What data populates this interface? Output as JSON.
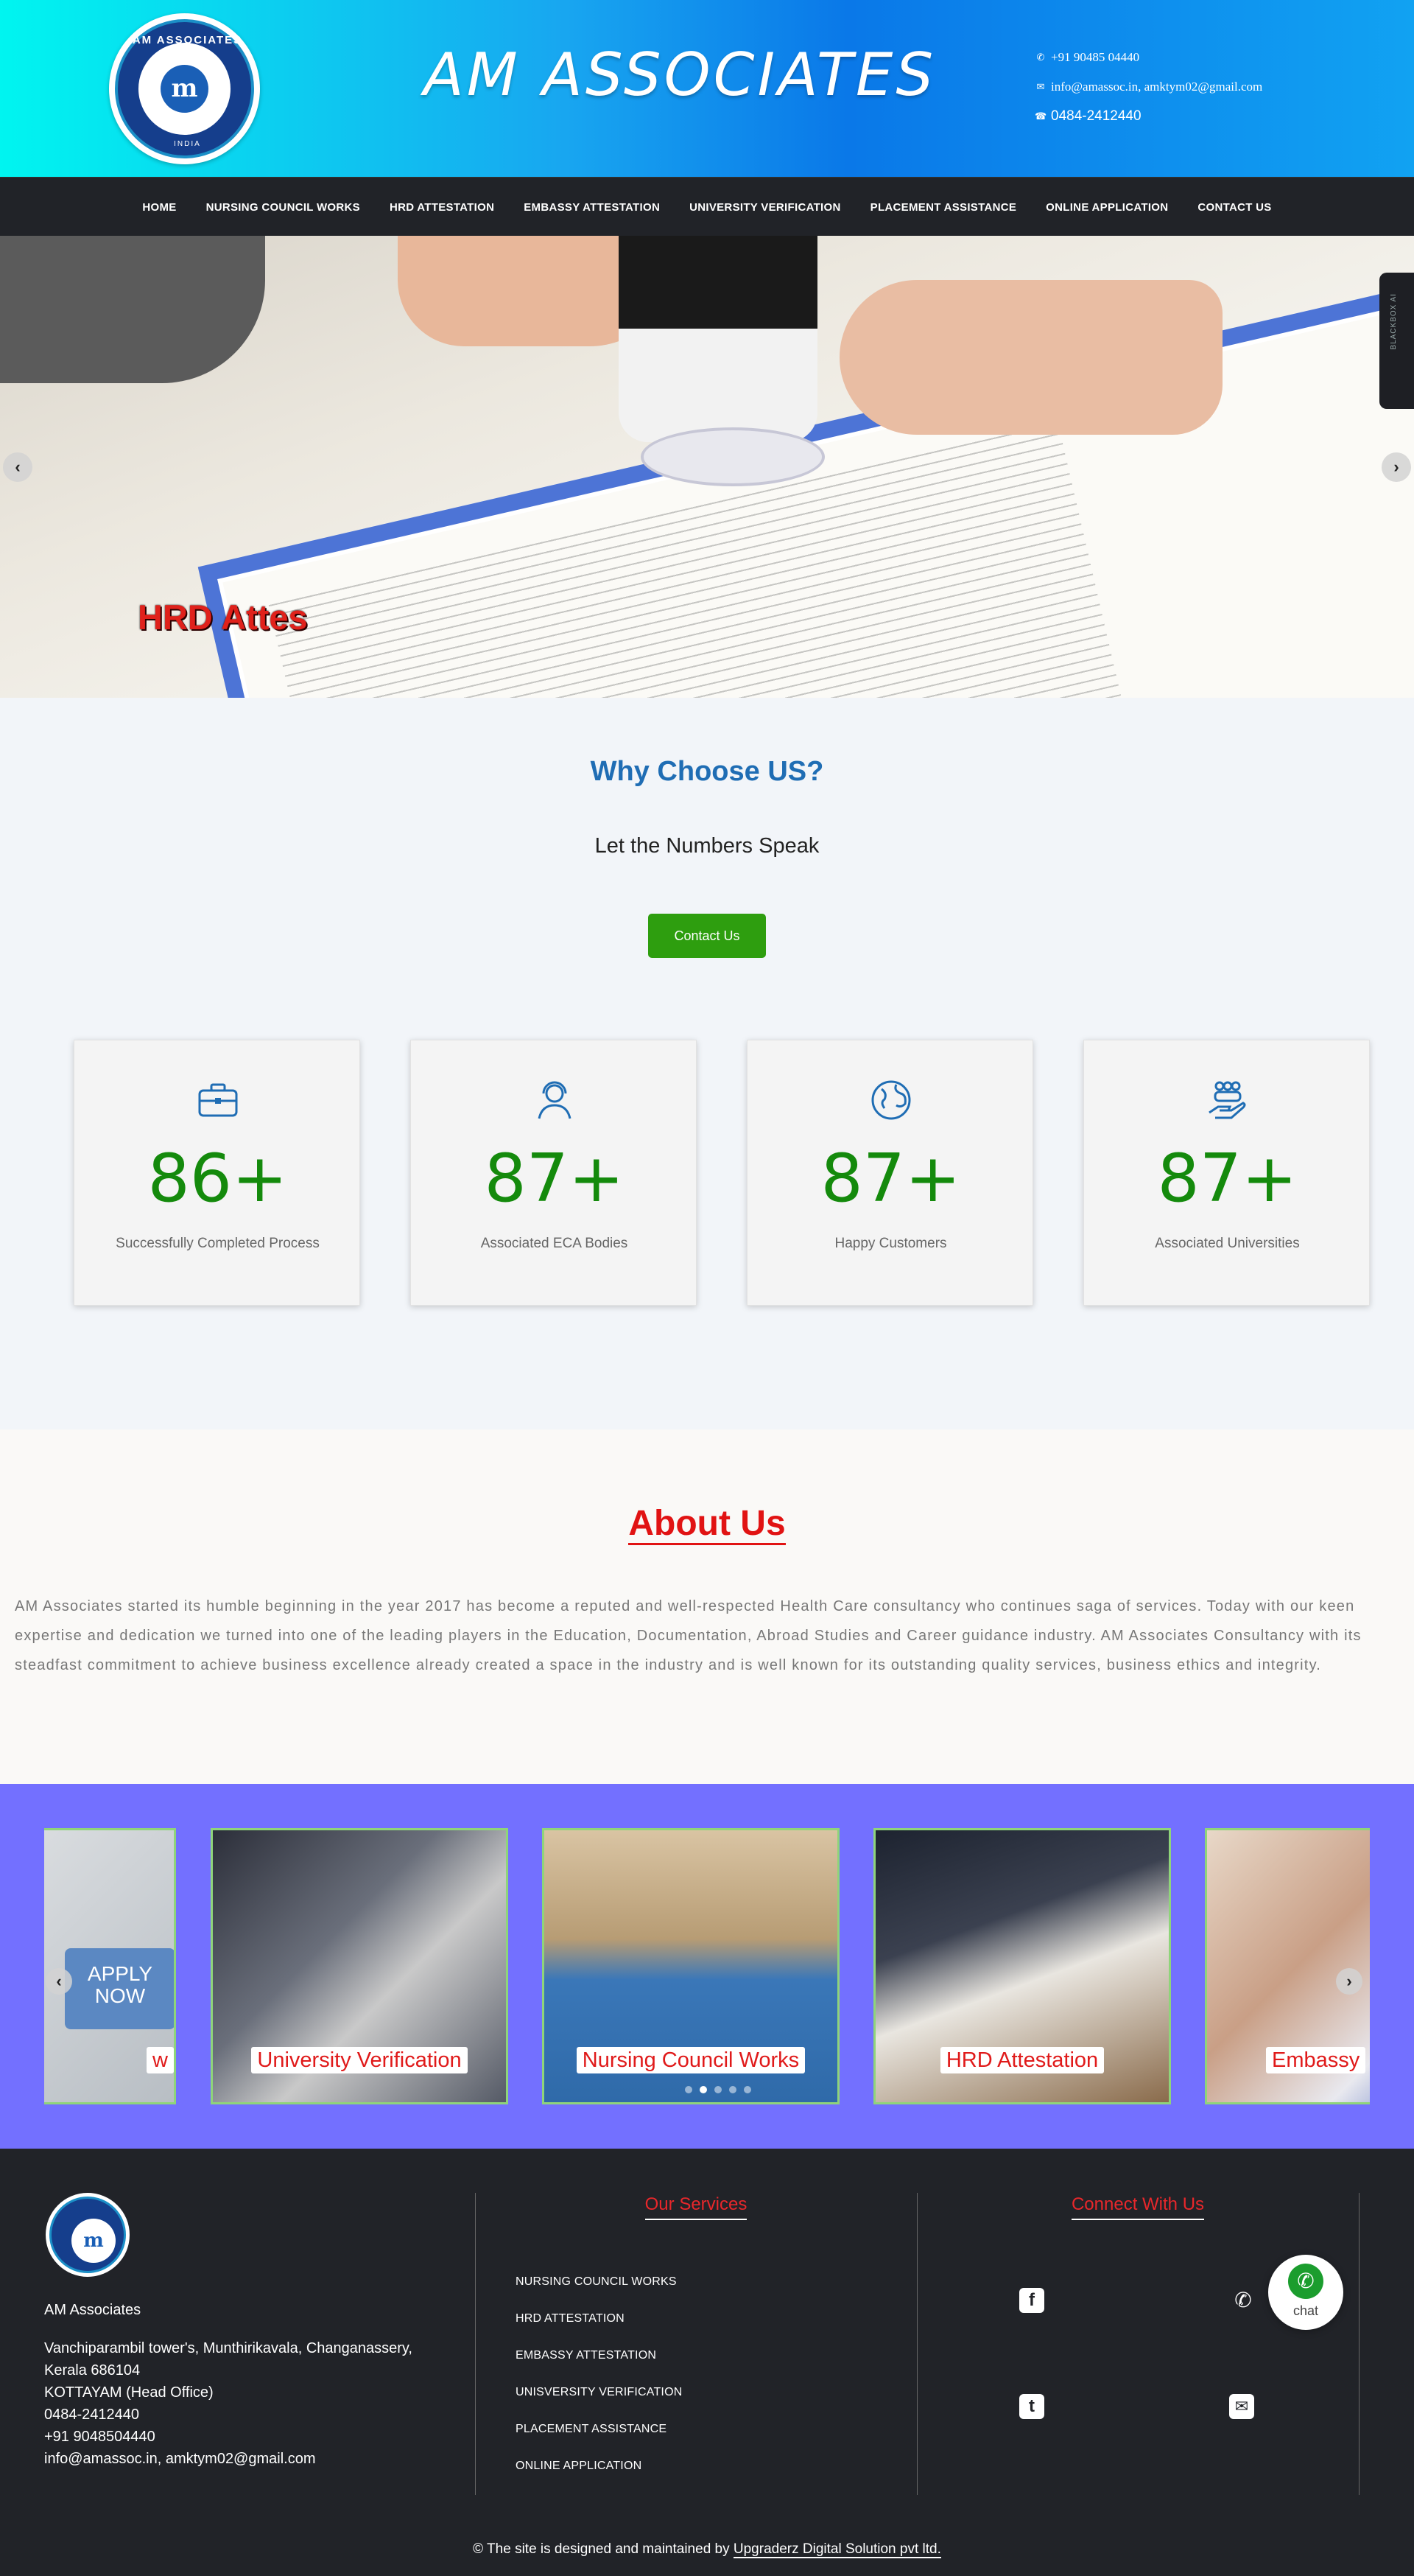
{
  "header": {
    "logo_top": "AM ASSOCIATES",
    "logo_bottom": "INDIA",
    "title": "AM ASSOCIATES",
    "whatsapp": "+91 90485 04440",
    "email": "info@amassoc.in, amktym02@gmail.com",
    "phone": "0484-2412440"
  },
  "nav": {
    "items": [
      "HOME",
      "NURSING COUNCIL WORKS",
      "HRD ATTESTATION",
      "EMBASSY ATTESTATION",
      "UNIVERSITY VERIFICATION",
      "PLACEMENT ASSISTANCE",
      "ONLINE APPLICATION",
      "CONTACT US"
    ]
  },
  "hero": {
    "caption": "HRD Attes",
    "prev": "‹",
    "next": "›",
    "side_tab": "BLACKBOX AI"
  },
  "why": {
    "title": "Why Choose US?",
    "subtitle": "Let the Numbers Speak",
    "button": "Contact Us",
    "cards": [
      {
        "icon": "briefcase-icon",
        "value": "86+",
        "label": "Successfully Completed Process"
      },
      {
        "icon": "support-agent-icon",
        "value": "87+",
        "label": "Associated ECA Bodies"
      },
      {
        "icon": "globe-icon",
        "value": "87+",
        "label": "Happy Customers"
      },
      {
        "icon": "hand-people-icon",
        "value": "87+",
        "label": "Associated Universities"
      }
    ]
  },
  "about": {
    "title": "About Us",
    "text": "AM Associates started its humble beginning in the year 2017 has become a reputed and well-respected Health Care consultancy who continues saga of services. Today with our keen expertise and dedication we turned into one of the leading players in the Education, Documentation, Abroad Studies and Career guidance industry. AM Associates Consultancy with its steadfast commitment to achieve business excellence already created a space in the industry and is well known for its outstanding quality services, business ethics and integrity."
  },
  "services": {
    "cards": [
      {
        "label": "w",
        "key_text": "APPLY NOW"
      },
      {
        "label": "University Verification"
      },
      {
        "label": "Nursing Council Works"
      },
      {
        "label": "HRD Attestation"
      },
      {
        "label": "Embassy"
      }
    ],
    "active_dot": 1,
    "dot_count": 5
  },
  "footer": {
    "name": "AM Associates",
    "address_lines": [
      "Vanchiparambil tower's, Munthirikavala, Changanassery,",
      "Kerala 686104",
      "KOTTAYAM (Head Office)",
      "0484-2412440",
      "+91 9048504440",
      "info@amassoc.in, amktym02@gmail.com"
    ],
    "services_title": "Our Services",
    "service_links": [
      "NURSING COUNCIL WORKS",
      "HRD ATTESTATION",
      "EMBASSY ATTESTATION",
      "UNISVERSITY VERIFICATION",
      "PLACEMENT ASSISTANCE",
      "ONLINE APPLICATION"
    ],
    "connect_title": "Connect With Us",
    "chat_label": "chat",
    "copyright_text": "© The site is designed and maintained by ",
    "copyright_link": "Upgraderz Digital Solution pvt ltd."
  }
}
